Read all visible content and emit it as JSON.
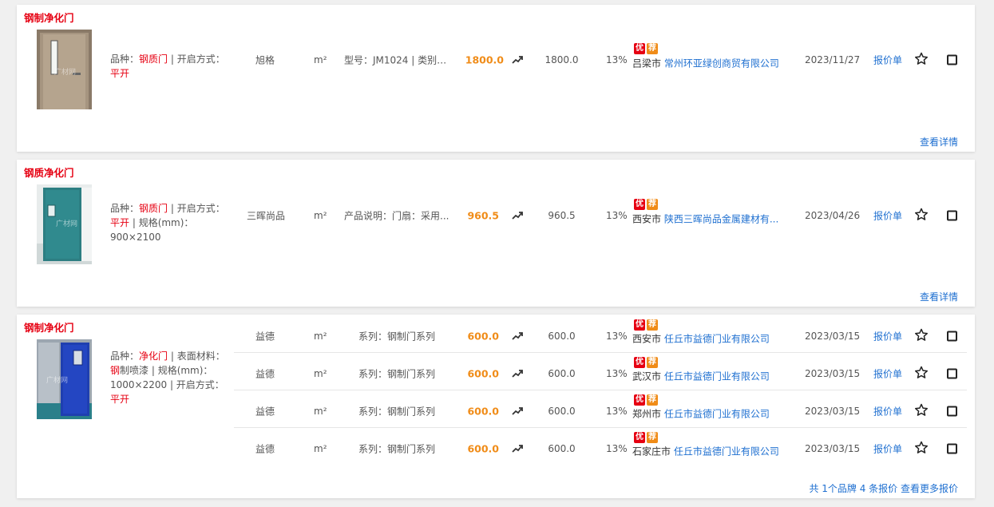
{
  "cards": [
    {
      "title": "钢制净化门",
      "spec": {
        "l1": "品种：",
        "v1": "钢质门",
        "s1": " | 开启方式：",
        "v2": "平开",
        "s2": "",
        "tail": ""
      },
      "rows": [
        {
          "brand": "旭格",
          "unit": "m²",
          "desc": "型号：JM1024 | 类别：...",
          "price": "1800.0",
          "price2": "1800.0",
          "tax": "13%",
          "badge1": "优",
          "badge2": "荐",
          "city": "吕梁市",
          "company": "常州环亚绿创商贸有限公司",
          "date": "2023/11/27",
          "quote": "报价单"
        }
      ],
      "link": "查看详情"
    },
    {
      "title": "钢质净化门",
      "spec": {
        "l1": "品种：",
        "v1": "钢质门",
        "s1": " | 开启方式：",
        "v2": "平开",
        "s2": " | 规格(mm)：",
        "tail": "900×2100"
      },
      "rows": [
        {
          "brand": "三晖尚品",
          "unit": "m²",
          "desc": "产品说明：门扇：采用...",
          "price": "960.5",
          "price2": "960.5",
          "tax": "13%",
          "badge1": "优",
          "badge2": "荐",
          "city": "西安市",
          "company": "陕西三晖尚品金属建材有...",
          "date": "2023/04/26",
          "quote": "报价单"
        }
      ],
      "link": "查看详情"
    },
    {
      "title": "钢制净化门",
      "spec": {
        "l1": "品种：",
        "v1": "净化门",
        "s1": " | 表面材料：",
        "v2": "钢",
        "s2": "制喷漆 | 规格(mm)：1000×2200 | 开启方式：",
        "tail": "平开"
      },
      "rows": [
        {
          "brand": "益德",
          "unit": "m²",
          "desc": "系列：钢制门系列",
          "price": "600.0",
          "price2": "600.0",
          "tax": "13%",
          "badge1": "优",
          "badge2": "荐",
          "city": "西安市",
          "company": "任丘市益德门业有限公司",
          "date": "2023/03/15",
          "quote": "报价单"
        },
        {
          "brand": "益德",
          "unit": "m²",
          "desc": "系列：钢制门系列",
          "price": "600.0",
          "price2": "600.0",
          "tax": "13%",
          "badge1": "优",
          "badge2": "荐",
          "city": "武汉市",
          "company": "任丘市益德门业有限公司",
          "date": "2023/03/15",
          "quote": "报价单"
        },
        {
          "brand": "益德",
          "unit": "m²",
          "desc": "系列：钢制门系列",
          "price": "600.0",
          "price2": "600.0",
          "tax": "13%",
          "badge1": "优",
          "badge2": "荐",
          "city": "郑州市",
          "company": "任丘市益德门业有限公司",
          "date": "2023/03/15",
          "quote": "报价单"
        },
        {
          "brand": "益德",
          "unit": "m²",
          "desc": "系列：钢制门系列",
          "price": "600.0",
          "price2": "600.0",
          "tax": "13%",
          "badge1": "优",
          "badge2": "荐",
          "city": "石家庄市",
          "company": "任丘市益德门业有限公司",
          "date": "2023/03/15",
          "quote": "报价单"
        }
      ],
      "footer": {
        "summary": "共 1个品牌 4 条报价",
        "more": "查看更多报价"
      }
    }
  ],
  "watermark": "广材网",
  "colors": {
    "accent_red": "#e60012",
    "price_orange": "#f08c18",
    "link_blue": "#1e6fd0"
  }
}
